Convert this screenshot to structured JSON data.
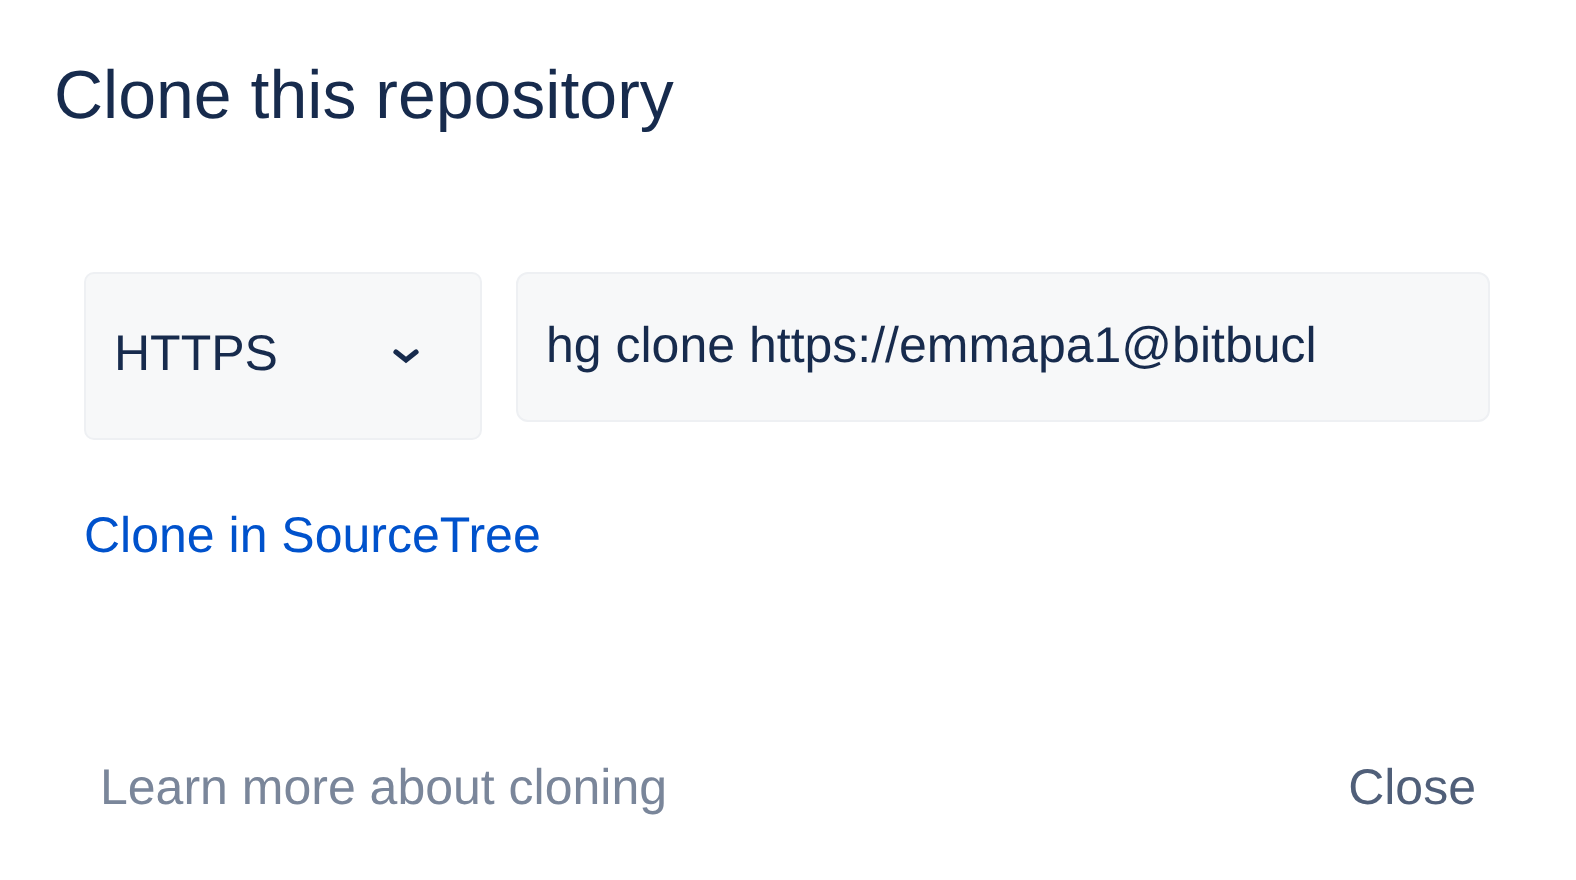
{
  "dialog": {
    "title": "Clone this repository",
    "protocol_select": {
      "value": "HTTPS"
    },
    "clone_command": {
      "value": "hg clone https://emmapa1@bitbucl"
    },
    "sourcetree_link": "Clone in SourceTree",
    "footer": {
      "learn_more_link": "Learn more about cloning",
      "close_button": "Close"
    }
  }
}
